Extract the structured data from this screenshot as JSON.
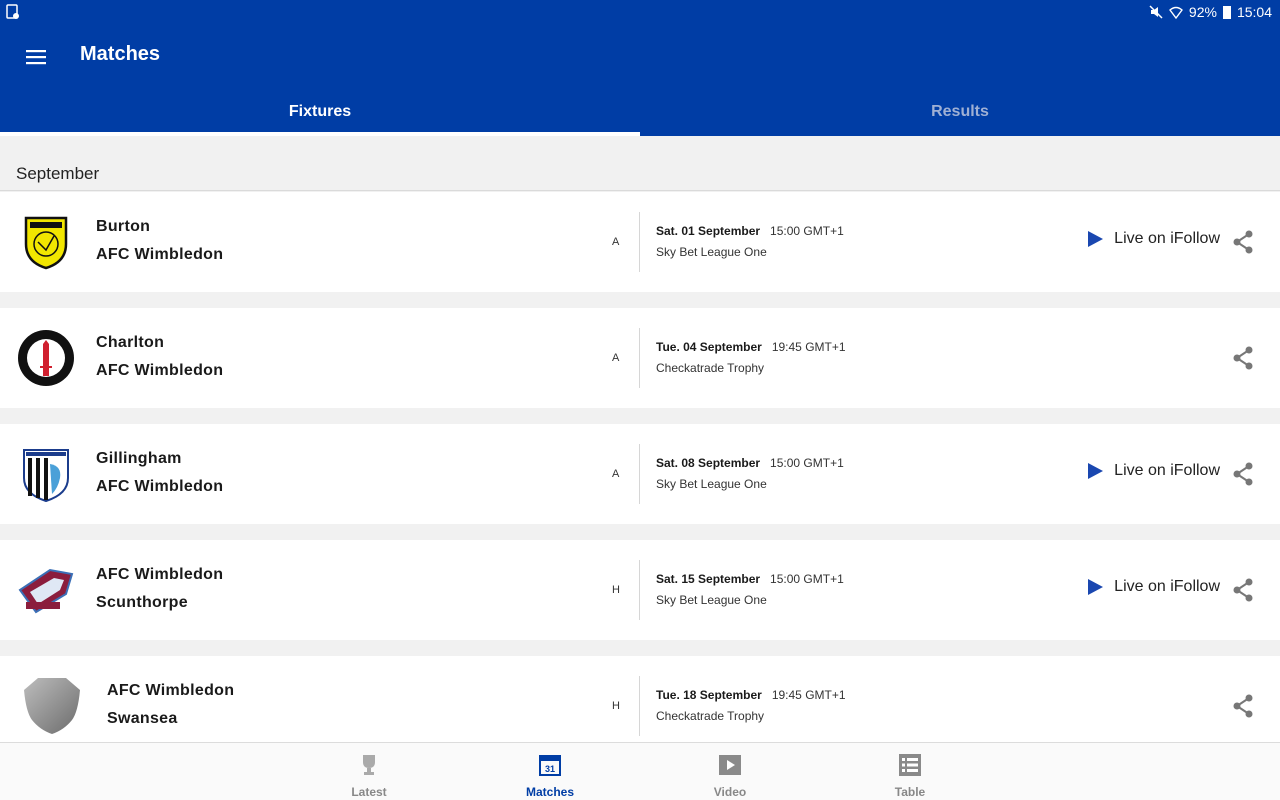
{
  "status_bar": {
    "battery": "92%",
    "time": "15:04"
  },
  "app": {
    "title": "Matches"
  },
  "tabs": [
    {
      "label": "Fixtures",
      "active": true
    },
    {
      "label": "Results",
      "active": false
    }
  ],
  "section": {
    "month": "September"
  },
  "fixtures": [
    {
      "team1": "Burton",
      "team2": "AFC Wimbledon",
      "venue": "A",
      "date": "Sat. 01 September",
      "time": "15:00 GMT+1",
      "competition": "Sky Bet League One",
      "live": "Live on iFollow",
      "crest_icon": "burton-crest-icon"
    },
    {
      "team1": "Charlton",
      "team2": "AFC Wimbledon",
      "venue": "A",
      "date": "Tue. 04 September",
      "time": "19:45 GMT+1",
      "competition": "Checkatrade Trophy",
      "live": "",
      "crest_icon": "charlton-crest-icon"
    },
    {
      "team1": "Gillingham",
      "team2": "AFC Wimbledon",
      "venue": "A",
      "date": "Sat. 08 September",
      "time": "15:00 GMT+1",
      "competition": "Sky Bet League One",
      "live": "Live on iFollow",
      "crest_icon": "gillingham-crest-icon"
    },
    {
      "team1": "AFC Wimbledon",
      "team2": "Scunthorpe",
      "venue": "H",
      "date": "Sat. 15 September",
      "time": "15:00 GMT+1",
      "competition": "Sky Bet League One",
      "live": "Live on iFollow",
      "crest_icon": "scunthorpe-crest-icon"
    },
    {
      "team1": "AFC Wimbledon",
      "team2": "Swansea",
      "venue": "H",
      "date": "Tue. 18 September",
      "time": "19:45 GMT+1",
      "competition": "Checkatrade Trophy",
      "live": "",
      "crest_icon": "placeholder-shield-icon"
    }
  ],
  "bottom_nav": [
    {
      "label": "Latest",
      "icon": "trophy-icon",
      "active": false
    },
    {
      "label": "Matches",
      "icon": "calendar-icon",
      "calendar_day": "31",
      "active": true
    },
    {
      "label": "Video",
      "icon": "play-icon",
      "active": false
    },
    {
      "label": "Table",
      "icon": "list-icon",
      "active": false
    }
  ],
  "colors": {
    "brand_blue": "#003da5",
    "play_blue": "#1a47b0",
    "inactive_tab": "#9fb0d4"
  }
}
